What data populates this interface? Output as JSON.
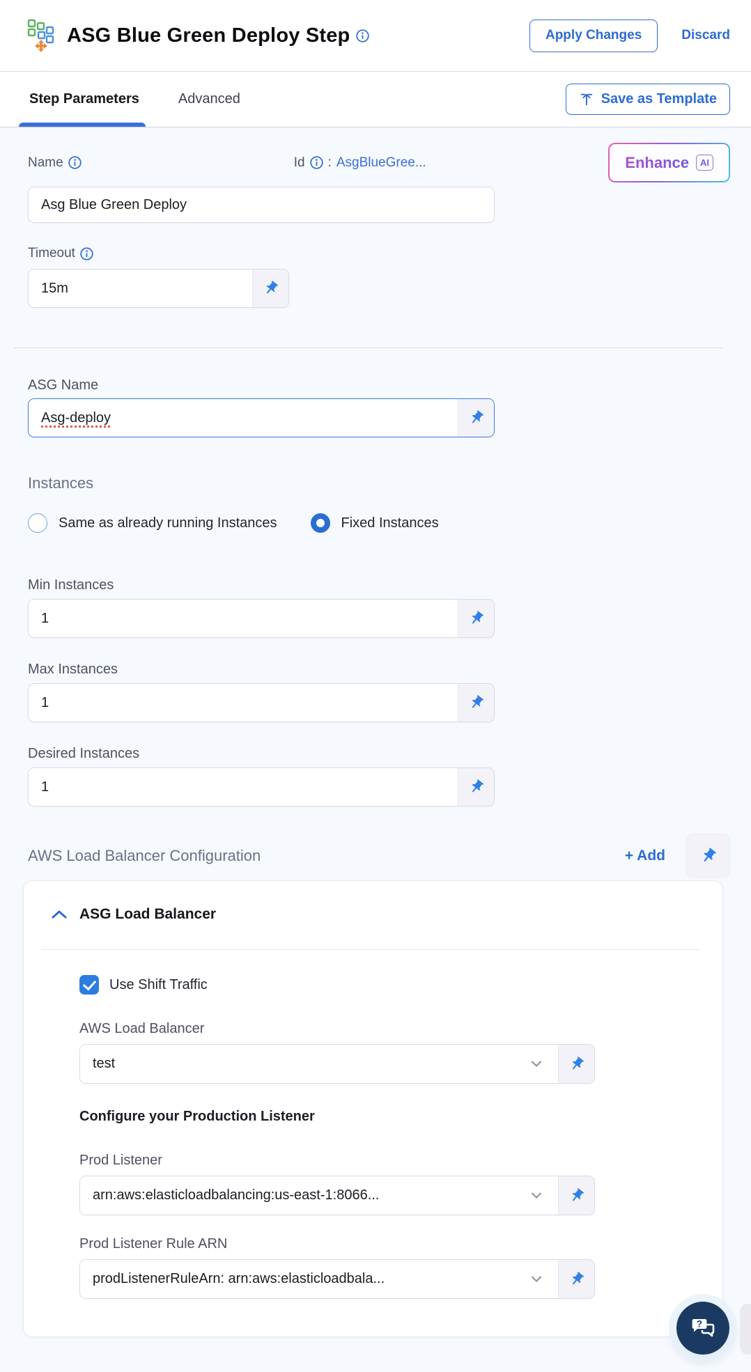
{
  "header": {
    "title": "ASG Blue Green Deploy Step",
    "apply_label": "Apply Changes",
    "discard_label": "Discard"
  },
  "tabs": {
    "step_parameters": "Step Parameters",
    "advanced": "Advanced",
    "active_tab": "Step Parameters",
    "save_as_template_label": "Save as Template"
  },
  "form": {
    "name": {
      "label": "Name",
      "value": "Asg Blue Green Deploy"
    },
    "id": {
      "label": "Id",
      "separator": ":",
      "value": "AsgBlueGree..."
    },
    "enhance": {
      "label": "Enhance",
      "badge": "AI"
    },
    "timeout": {
      "label": "Timeout",
      "value": "15m"
    },
    "asg_name": {
      "label": "ASG Name",
      "value": "Asg-deploy",
      "spellcheck_flagged": true
    },
    "instances": {
      "heading": "Instances",
      "option_same": "Same as already running Instances",
      "option_fixed": "Fixed Instances",
      "selected": "Fixed Instances"
    },
    "min_instances": {
      "label": "Min Instances",
      "value": "1"
    },
    "max_instances": {
      "label": "Max Instances",
      "value": "1"
    },
    "desired_instances": {
      "label": "Desired Instances",
      "value": "1"
    }
  },
  "lb_section": {
    "heading": "AWS Load Balancer Configuration",
    "add_label": "+ Add",
    "card": {
      "title": "ASG Load Balancer",
      "collapsed": false,
      "use_shift_traffic_label": "Use Shift Traffic",
      "use_shift_traffic_checked": true,
      "aws_lb": {
        "label": "AWS Load Balancer",
        "value": "test"
      },
      "prod_heading": "Configure your Production Listener",
      "prod_listener": {
        "label": "Prod Listener",
        "value": "arn:aws:elasticloadbalancing:us-east-1:8066..."
      },
      "prod_listener_rule": {
        "label": "Prod Listener Rule ARN",
        "value": "prodListenerRuleArn: arn:aws:elasticloadbala..."
      }
    }
  },
  "icons": {
    "info": "circled-i",
    "pin": "pushpin",
    "chevron_down": "v",
    "chevron_up": "^",
    "save_template": "upload-arrow",
    "help_chat": "question-speech-bubbles"
  },
  "colors": {
    "primary_blue": "#2e6bd4",
    "pin_blue": "#2f80e8",
    "tab_underline": "#3b6fd7",
    "content_bg": "#f6f9fd",
    "checkbox_blue": "#2b7de0",
    "fab_navy": "#1b3a63",
    "enhance_gradient_start": "#ef5fa8",
    "enhance_gradient_end": "#42c8dd",
    "spellcheck_red": "#e2574f"
  }
}
